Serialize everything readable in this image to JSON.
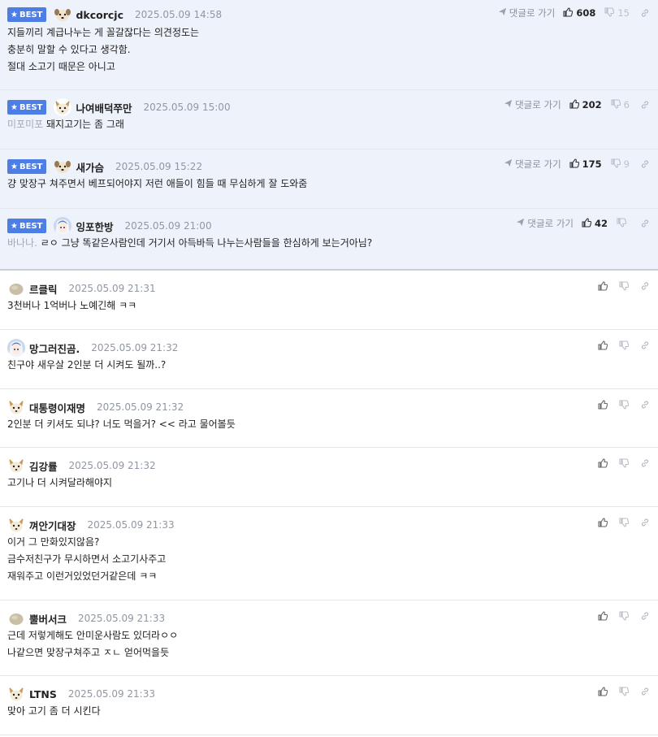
{
  "comments": [
    {
      "best": true,
      "nick": "dkcorcjc",
      "date": "2025.05.09 14:58",
      "avatar": "dog-face",
      "reply_label": "댓글로 가기",
      "likes": "608",
      "dislikes": "15",
      "prefix": "",
      "text": "지들끼리 계급나누는 게 꼴갈잖다는 의견정도는\n충분히 말할 수 있다고 생각함.\n절대 소고기 때문은 아니고"
    },
    {
      "best": true,
      "nick": "나여배덕쭈만",
      "date": "2025.05.09 15:00",
      "avatar": "fox-face",
      "reply_label": "댓글로 가기",
      "likes": "202",
      "dislikes": "6",
      "prefix": "미포미포 ",
      "text": "돼지고기는 좀 그래"
    },
    {
      "best": true,
      "nick": "새가슴",
      "date": "2025.05.09 15:22",
      "avatar": "dog-face",
      "reply_label": "댓글로 가기",
      "likes": "175",
      "dislikes": "9",
      "prefix": "",
      "text": "걍 맞장구 쳐주면서 베프되어야지 저런 애들이 힘들 때 무심하게 잘 도와줌"
    },
    {
      "best": true,
      "nick": "잉포한방",
      "date": "2025.05.09 21:00",
      "avatar": "anime-face",
      "reply_label": "댓글로 가기",
      "likes": "42",
      "dislikes": "",
      "prefix": "바나나. ",
      "text": "ㄹㅇ 그냥 똑같은사람인데 거기서 아득바득 나누는사람들을 한심하게 보는거아님?"
    },
    {
      "best": false,
      "nick": "르클릭",
      "date": "2025.05.09 21:31",
      "avatar": "pebble",
      "text": "3천버나 1억버나 노예긴해 ㅋㅋ"
    },
    {
      "best": false,
      "nick": "망그러진곰.",
      "date": "2025.05.09 21:32",
      "avatar": "anime-face",
      "text": "친구야 새우살 2인분 더 시켜도 될까..?"
    },
    {
      "best": false,
      "nick": "대통령이재명",
      "date": "2025.05.09 21:32",
      "avatar": "fox-face",
      "text": "2인분 더 키셔도 되냐? 너도 먹을거? << 라고 물어볼듯"
    },
    {
      "best": false,
      "nick": "김강률",
      "date": "2025.05.09 21:32",
      "avatar": "fox-face",
      "text": "고기나 더 시켜달라해야지"
    },
    {
      "best": false,
      "nick": "껴안기대장",
      "date": "2025.05.09 21:33",
      "avatar": "fox-face",
      "text": "이거 그 만화있지않음?\n금수저친구가 무시하면서 소고기사주고\n재워주고 이런거있었던거같은데 ㅋㅋ"
    },
    {
      "best": false,
      "nick": "뿔버서크",
      "date": "2025.05.09 21:33",
      "avatar": "pebble",
      "text": "근데 저렇게해도 안미운사람도 있더라ㅇㅇ\n나같으면 맞장구쳐주고 ㅈㄴ 얻어먹을듯"
    },
    {
      "best": false,
      "nick": "LTNS",
      "date": "2025.05.09 21:33",
      "avatar": "fox-face",
      "text": "맞아 고기 좀 더 시킨다"
    }
  ],
  "labels": {
    "best": "BEST"
  },
  "colors": {
    "best_bg": "#eef2fb",
    "badge": "#4d7ee6",
    "date": "#9097a3"
  },
  "icons": {
    "reply": "send-arrow-icon",
    "like": "thumbs-up-icon",
    "dislike": "thumbs-down-icon",
    "link": "link-icon",
    "best": "star-icon"
  }
}
